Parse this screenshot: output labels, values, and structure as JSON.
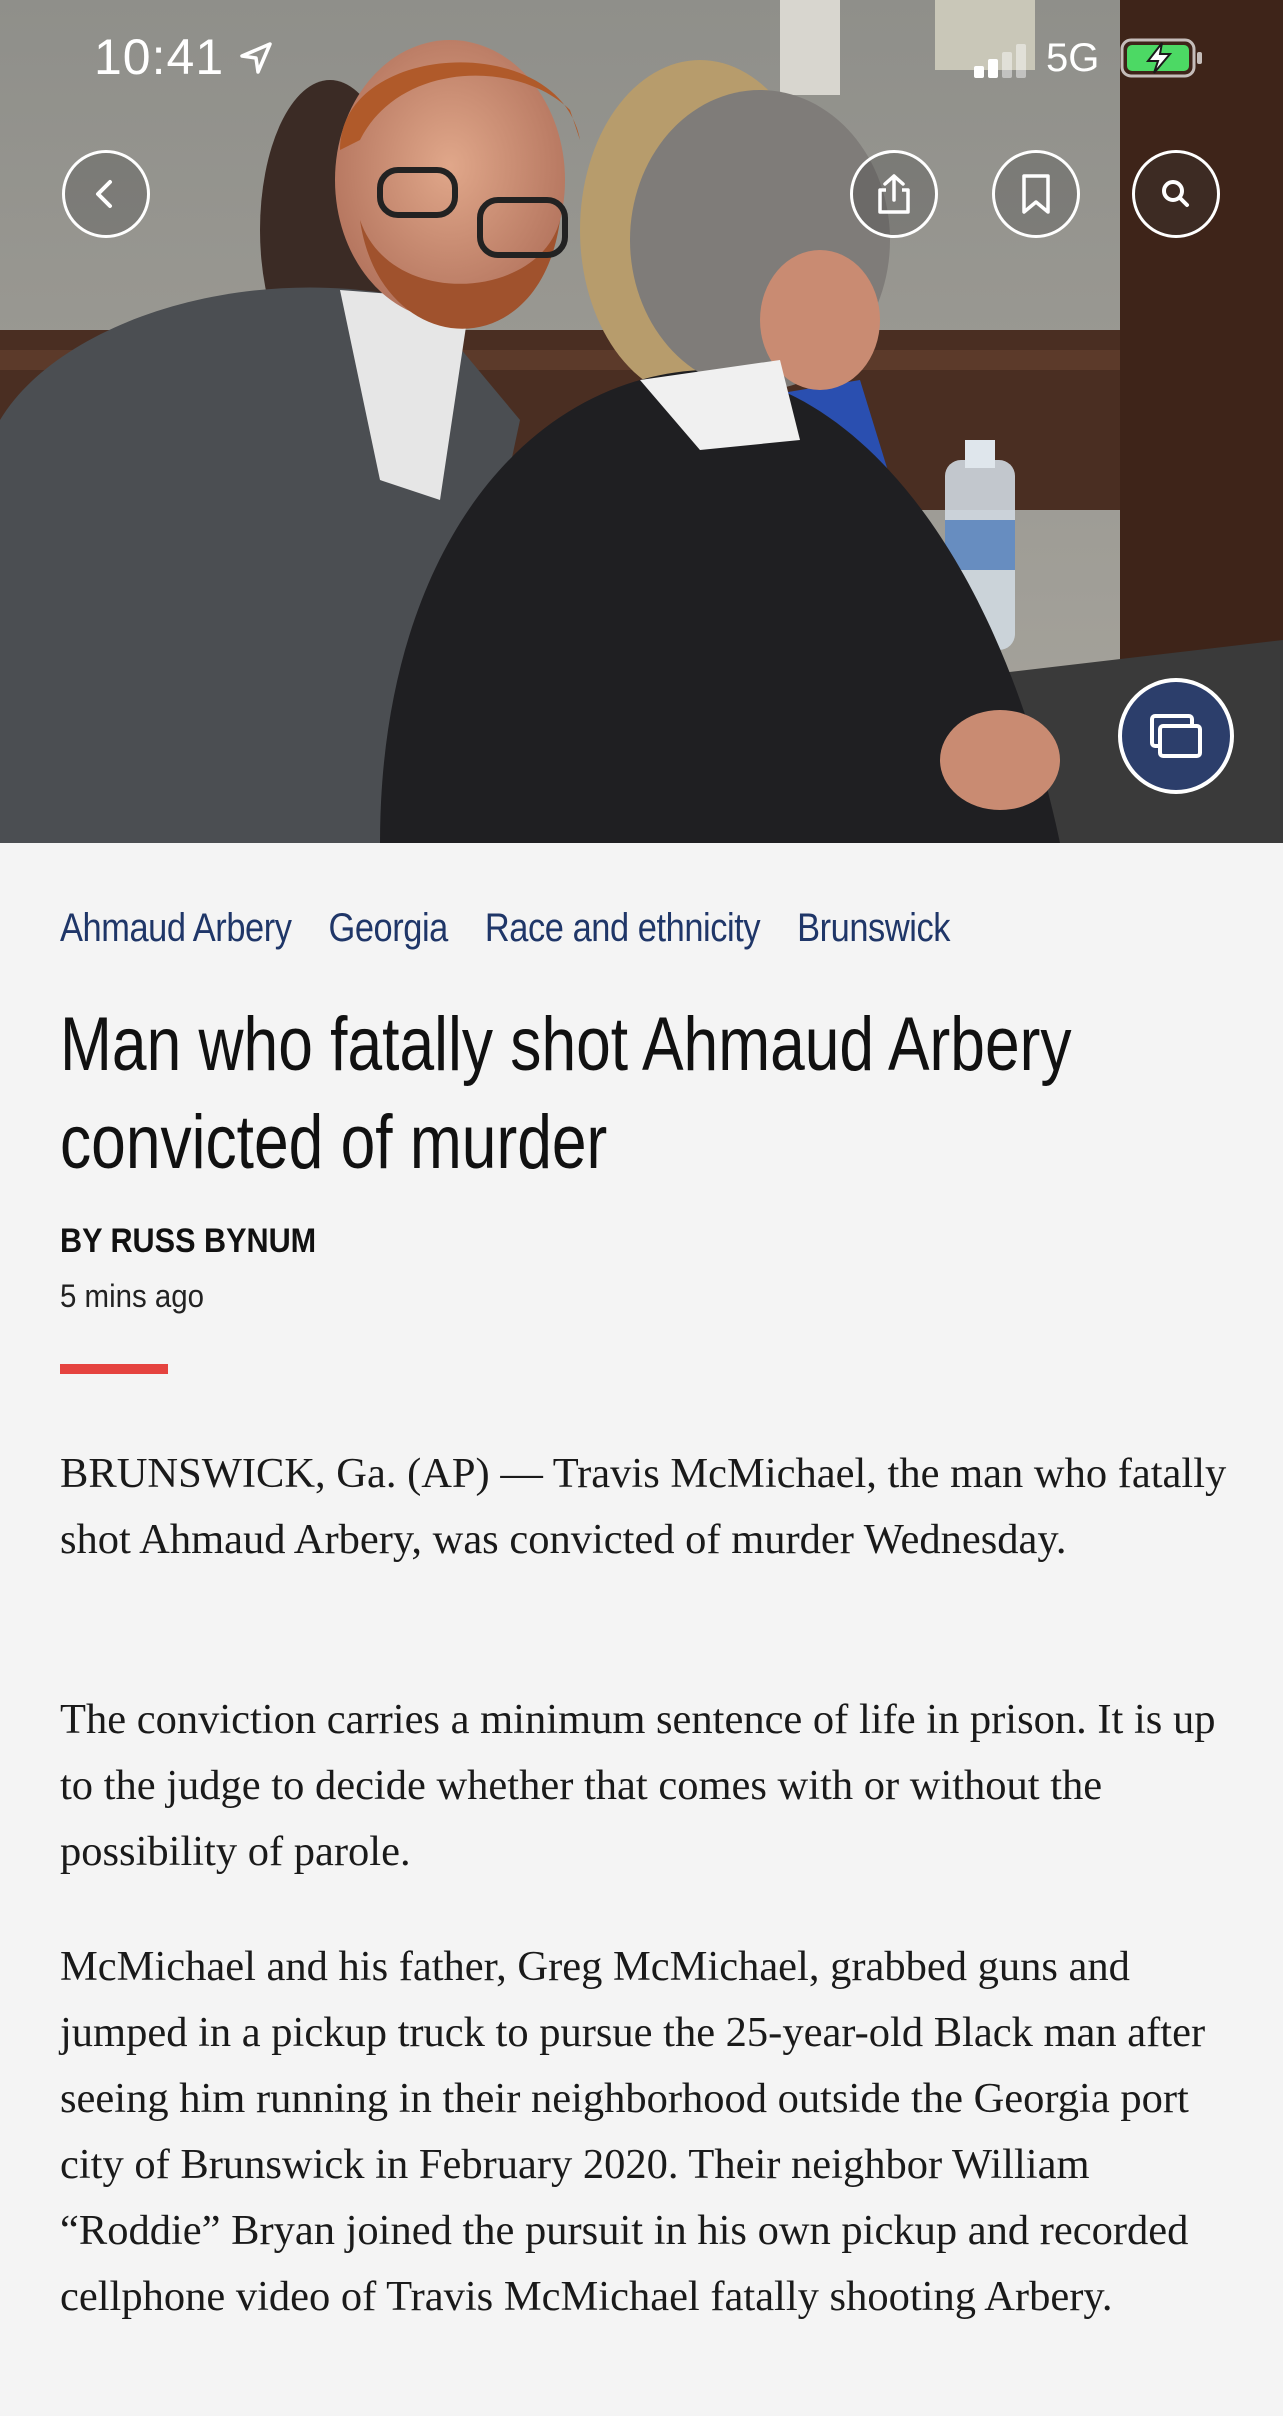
{
  "status_bar": {
    "time": "10:41",
    "network": "5G"
  },
  "hero": {
    "icons": {
      "back": "chevron-left-icon",
      "share": "share-icon",
      "bookmark": "bookmark-icon",
      "search": "search-icon",
      "gallery": "gallery-icon"
    }
  },
  "article": {
    "tags": [
      "Ahmaud Arbery",
      "Georgia",
      "Race and ethnicity",
      "Brunswick"
    ],
    "headline": "Man who fatally shot Ahmaud Arbery convicted of murder",
    "byline": "BY RUSS BYNUM",
    "timestamp": "5 mins ago",
    "paragraphs": [
      "BRUNSWICK, Ga. (AP) — Travis McMichael, the man who fatally shot Ahmaud Arbery, was convicted of murder Wednesday.",
      "The conviction carries a minimum sentence of life in prison. It is up to the judge to decide whether that comes with or without the possibility of parole.",
      "McMichael and his father, Greg McMichael, grabbed guns and jumped in a pickup truck to pursue the 25-year-old Black man after seeing him running in their neighborhood outside the Georgia port city of Brunswick in February 2020. Their neighbor William “Roddie” Bryan joined the pursuit in his own pickup and recorded cellphone video of Travis McMichael fatally shooting Arbery."
    ]
  },
  "colors": {
    "tag": "#1f3668",
    "accent_rule": "#e5433f",
    "gallery_button": "#2c3e6b",
    "battery": "#4cd964"
  }
}
